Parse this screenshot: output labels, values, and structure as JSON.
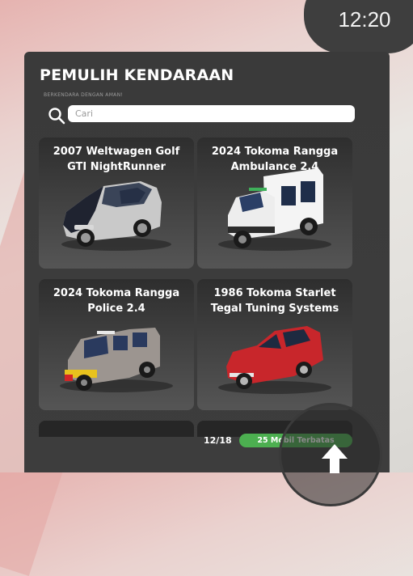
{
  "clock": {
    "time": "12:20"
  },
  "panel": {
    "title": "PEMULIH KENDARAAN",
    "subtitle": "BERKENDARA DENGAN AMAN!",
    "search": {
      "placeholder": "Cari",
      "value": ""
    }
  },
  "vehicles": [
    {
      "name": "2007 Weltwagen Golf GTI NightRunner",
      "body_color": "#c9c9c9",
      "icon": "hatchback-car-icon"
    },
    {
      "name": "2024 Tokoma Rangga Ambulance 2.4",
      "body_color": "#f4f4f4",
      "icon": "ambulance-truck-icon"
    },
    {
      "name": "2024 Tokoma Rangga Police 2.4",
      "body_color": "#9c9590",
      "icon": "police-suv-icon"
    },
    {
      "name": "1986 Tokoma Starlet Tegal Tuning Systems",
      "body_color": "#c8262b",
      "icon": "compact-car-icon"
    }
  ],
  "footer": {
    "page": "12/18",
    "badge": "25 Mobil Terbatas",
    "badge_color": "#4caf50"
  }
}
